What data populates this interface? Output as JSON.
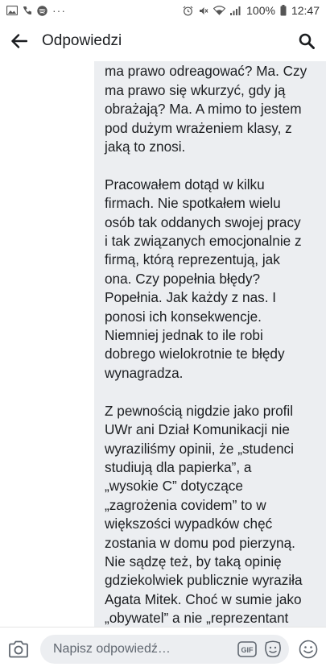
{
  "status_bar": {
    "time": "12:47",
    "battery": "100%",
    "overflow": "···"
  },
  "header": {
    "title": "Odpowiedzi"
  },
  "comment": {
    "paragraphs": [
      "na nią spiralę. Czy jako człowiek\nma prawo odreagować? Ma. Czy\nma prawo się wkurzyć, gdy ją\nobrażają? Ma. A mimo to jestem\npod dużym wrażeniem klasy, z\njaką to znosi.",
      "Pracowałem dotąd w kilku\nfirmach. Nie spotkałem wielu\nosób tak oddanych swojej pracy\ni tak związanych emocjonalnie z\nfirmą, którą reprezentują, jak\nona. Czy popełnia błędy?\nPopełnia. Jak każdy z nas. I\nponosi ich konsekwencje.\nNiemniej jednak to ile robi\ndobrego wielokrotnie te błędy\nwynagradza.",
      "Z pewnością nigdzie jako profil\nUWr ani Dział Komunikacji nie\nwyraziliśmy opinii, że „studenci\nstudiują dla papierka”, a\n„wysokie C” dotyczące\n„zagrożenia covidem” to w\nwiększości wypadków chęć\nzostania w domu pod pierzyną.\nNie sądzę też, by taką opinię\ngdziekolwiek publicznie wyraziła\nAgata Mitek. Choć w sumie jako\n„obywatel” a nie „reprezentant\ninstytucji” miałaby do tego\nprawo. To od Państwa – kadry"
    ]
  },
  "composer": {
    "placeholder": "Napisz odpowiedź…",
    "gif_label": "GIF"
  },
  "colors": {
    "accent": "#1c1e21",
    "bubble_bg": "#eceef1",
    "input_bg": "#eceef1"
  },
  "icons": {
    "back": "arrow-left-icon",
    "search": "search-icon",
    "camera": "camera-icon",
    "gif": "gif-icon",
    "sticker": "sticker-icon",
    "emoji": "emoji-icon"
  }
}
